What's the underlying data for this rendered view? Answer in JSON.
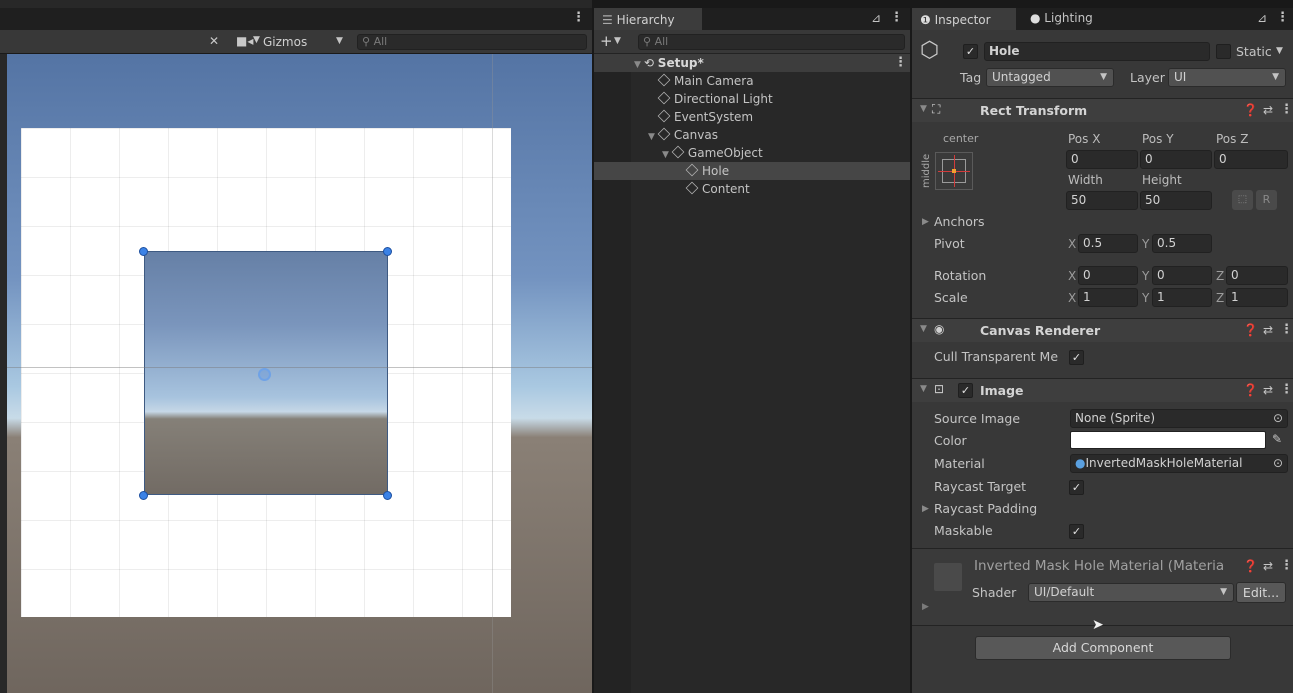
{
  "scene": {
    "toolbar": {
      "gizmos_label": "Gizmos",
      "search_placeholder": "All"
    }
  },
  "hierarchy": {
    "tab_label": "Hierarchy",
    "search_placeholder": "All",
    "scene_name": "Setup*",
    "items": [
      {
        "label": "Main Camera",
        "depth": 1
      },
      {
        "label": "Directional Light",
        "depth": 1
      },
      {
        "label": "EventSystem",
        "depth": 1
      },
      {
        "label": "Canvas",
        "depth": 1
      },
      {
        "label": "GameObject",
        "depth": 2
      },
      {
        "label": "Hole",
        "depth": 3,
        "selected": true
      },
      {
        "label": "Content",
        "depth": 3
      }
    ]
  },
  "inspector": {
    "tabs": {
      "inspector": "Inspector",
      "lighting": "Lighting"
    },
    "object": {
      "name": "Hole",
      "active": true,
      "static_label": "Static",
      "tag_label": "Tag",
      "tag_value": "Untagged",
      "layer_label": "Layer",
      "layer_value": "UI"
    },
    "rect_transform": {
      "title": "Rect Transform",
      "anchor_h": "center",
      "anchor_v": "middle",
      "pos_x_label": "Pos X",
      "pos_y_label": "Pos Y",
      "pos_z_label": "Pos Z",
      "pos_x": "0",
      "pos_y": "0",
      "pos_z": "0",
      "width_label": "Width",
      "height_label": "Height",
      "width": "50",
      "height": "50",
      "r_button": "R",
      "anchors_label": "Anchors",
      "pivot_label": "Pivot",
      "pivot_x": "0.5",
      "pivot_y": "0.5",
      "rotation_label": "Rotation",
      "rot_x": "0",
      "rot_y": "0",
      "rot_z": "0",
      "scale_label": "Scale",
      "scale_x": "1",
      "scale_y": "1",
      "scale_z": "1",
      "x": "X",
      "y": "Y",
      "z": "Z"
    },
    "canvas_renderer": {
      "title": "Canvas Renderer",
      "cull_label": "Cull Transparent Me",
      "cull_checked": true
    },
    "image": {
      "title": "Image",
      "enabled": true,
      "source_image_label": "Source Image",
      "source_image_value": "None (Sprite)",
      "color_label": "Color",
      "color_value": "#ffffff",
      "material_label": "Material",
      "material_value": "InvertedMaskHoleMaterial",
      "raycast_target_label": "Raycast Target",
      "raycast_padding_label": "Raycast Padding",
      "maskable_label": "Maskable"
    },
    "material": {
      "title": "Inverted Mask Hole Material (Materia",
      "shader_label": "Shader",
      "shader_value": "UI/Default",
      "edit_button": "Edit..."
    },
    "add_component_button": "Add Component"
  }
}
